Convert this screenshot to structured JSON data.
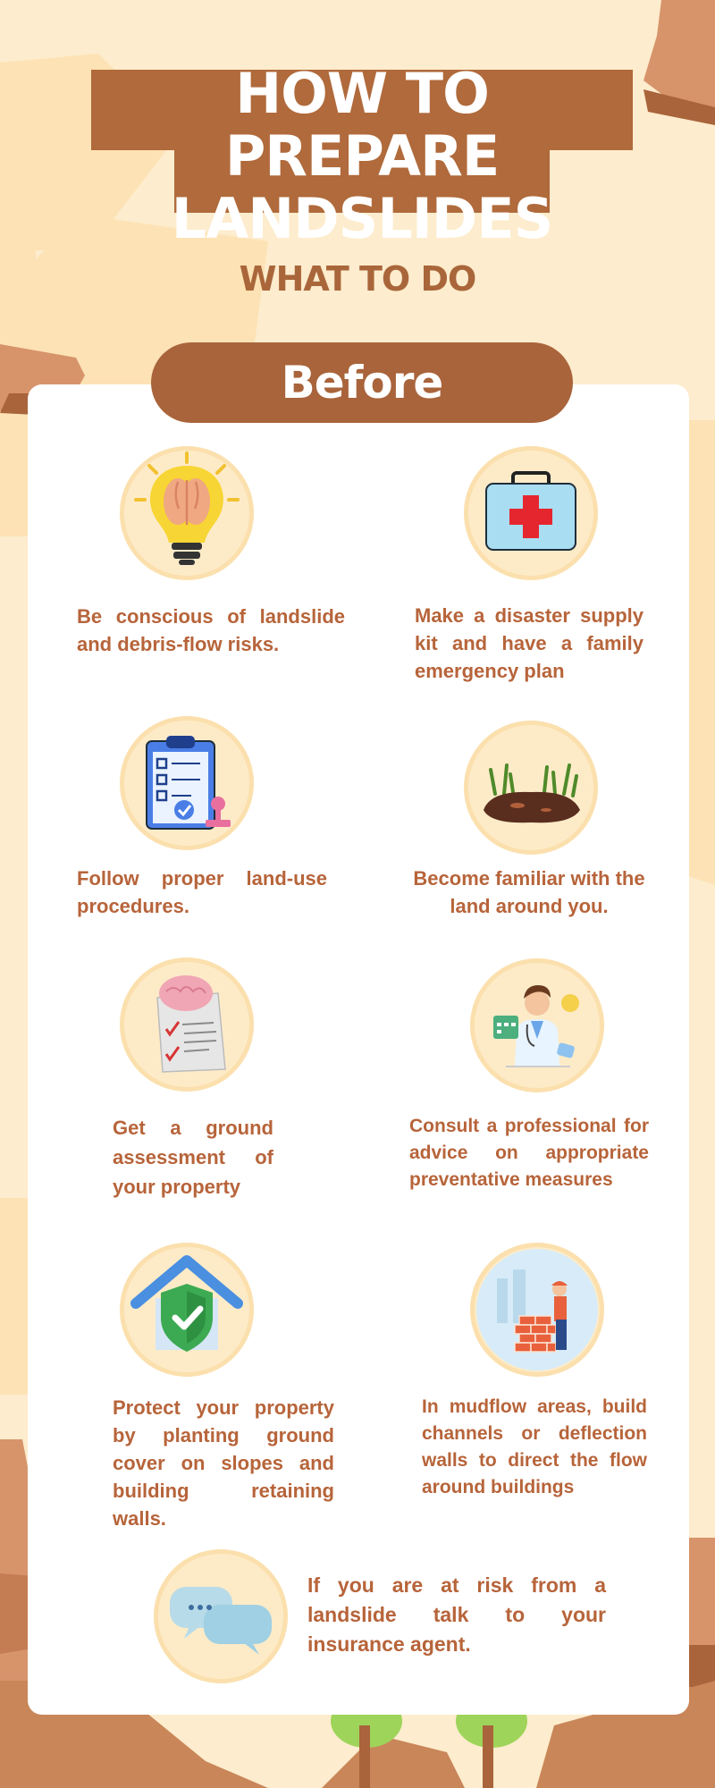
{
  "header": {
    "title_line1": "HOW TO PREPARE",
    "title_line2": "LANDSLIDES",
    "subtitle": "WHAT TO DO"
  },
  "section": {
    "label": "Before"
  },
  "tips": {
    "t1": "Be conscious of landslide and debris-flow risks.",
    "t2": "Make a disaster supply kit and have a family emergency plan",
    "t3": "Follow proper land-use procedures.",
    "t4": "Become familiar with the land around you.",
    "t5": "Get a ground assessment of your property",
    "t6": "Consult a professional for advice on appropriate preventative measures",
    "t7": "Protect your property by planting ground cover on slopes and building retaining walls.",
    "t8": "In mudflow areas, build channels or deflection walls to direct the flow around buildings",
    "t9": "If you are at risk from a landslide talk to your insurance agent."
  },
  "icons": [
    "lightbulb-brain-icon",
    "first-aid-kit-icon",
    "clipboard-checklist-icon",
    "grass-soil-icon",
    "brain-document-icon",
    "doctor-professional-icon",
    "shield-house-icon",
    "brick-wall-worker-icon",
    "chat-bubbles-icon"
  ],
  "colors": {
    "background": "#fdeccd",
    "brown": "#b06a3b",
    "text": "#b7643a",
    "card": "#ffffff",
    "icon_circle": "#fdebc8"
  }
}
